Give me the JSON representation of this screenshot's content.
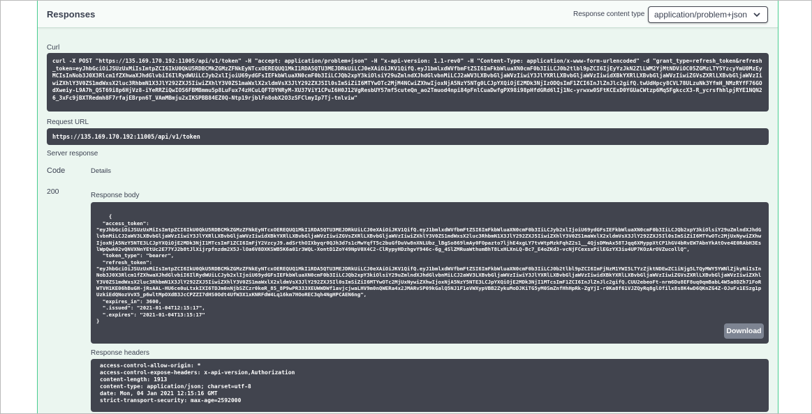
{
  "responses": {
    "title": "Responses",
    "content_type_label": "Response content type",
    "content_type_value": "application/problem+json"
  },
  "curl": {
    "label": "Curl",
    "command": "curl -X POST \"https://135.169.170.192:11005/api/v1/token\" -H \"accept: application/problem+json\" -H \"x-api-version: 1.1-rev0\" -H \"Content-Type: application/x-www-form-urlencoded\" -d \"grant_type=refresh_token&refresh_token=eyJhbGciOiJSUzUxMiIsImtpZCI6IkU0QkU5RDBCMkZGMzZFNkEyNTcxOEREQUQ1MkI1RDA5QTU3MEJDRkUiLCJ0eXAiOiJKV1QifQ.eyJ1bmlxdWVfbmFtZSI6ImFkbWluaXN0cmF0b3IiLCJ0b2tlbl9pZCI6IjEyYzJkN2ZlLWM2YjMtNDViOC05ZGMzLTY5YzcyYmU0MzEyMCIsInNob3J0X3Rlcm1fZXhwaXJhdGlvbiI6IlRydWUiLCJyb2xlIjoiU69ydGFsIEFkbWluaXN0cmF0b3IiLCJQb2xpY3kiOlsiY29uZmlndXJhdGlvbnMiLCJ2aWV3LXBvbGljaWVzIiwiY3JlYXRlLXBvbGljaWVzIiwidXBkYXRlLXBvbGljaWVzIiwiZGVsZXRlLXBvbGljaWVzIiwiZXhlY3V0ZS1mdWxsX2luc3RhbmN1X3JlY292ZXJ5IiwiZXhlY3V0ZS1maWxlX2xldmVsX3JlY292ZXJ5Il0sImSiZiI6MTYwOTc2MjM4NCwiZXhwIjoxNjA5NzY5NTg0LCJpYXQiOjE2MDk3NjIzODQsImF1ZCI6InJlZnJlc2gifQ.twUdHpcy8CVL78ULzuNk3YfmH_NMzRYfF76GOdXweiy-L9A7h_QST69i8p6HjVz8-iYeRRZiQwIOS6FBMBmmu5p8LuFux74zHCuLQFTDYNRyM-XU37ViY1CPuI6H0J12VgResbUY57mf5cuteQn_ao2Tmuod4npi84pFnlCuaDwfgPX98i98pHfdGRd6lIj1Nc-yrwxw0SFtKCExD0YGUaCWtzp6MqSFgkccX3-R_ycrsfhhlpjRYE1NQN26_3xFc9jBXTRedmh8F7rfajEBrpn6T_VAmMBmju2xIKSPBB84EZ0Q-Ntp19rjblFn8obX2O3zSFClmyIp7Tj-tnlviw\""
  },
  "request_url": {
    "label": "Request URL",
    "value": "https://135.169.170.192:11005/api/v1/token"
  },
  "server_response": {
    "label": "Server response",
    "code_header": "Code",
    "details_header": "Details",
    "code": "200",
    "body_label": "Response body",
    "body_text": "{\n  \"access_token\":\n\"eyJhbGciOiJSUzUxMiIsImtpZCI6IkU0QkU5RDBCMkZGMzZFNkEyNTcxOEREQUQ1MkI1RDA5QTU3MEJDRkUiLCJ0eXAiOiJKV1QifQ.eyJ1bmlxdWVfbmFtZSI6ImFkbWluaXN0cmF0b3IiLCJyb2xlIjoiU69ydGFsIEFkbWluaXN0cmF0b3IiLCJQb2xpY3kiOlsiY29uZmlndXJhdGlvbnMiLCJ2aWV3LXBvbGljaWVzIiwiY3JlYXRlLXBvbGljaWVzIiwidXBkYXRlLXBvbGljaWVzIiwiZGVsZXRlLXBvbGljaWVzIiwiZXhlY3V0ZS1mdWxsX2luc3RhbmN1X3JlY292ZXJ5IiwiZXhlY3V0ZS1maWxlX2xldmVsX3JlY292ZXJ5Il0sImSiZiI6MTYwOTc2MjUxNywiZXhwIjoxNjA5NzY5NTE3LCJpYXQiOjE2MDk3NjI1MTcsImF1ZCI6ImFjY2VzcyJ9.adSrthOIXbyqr0QJh3d7s1cMwYqfT5c2buGfDuVw8nXNLUbz_lBgSo869lmAy0FOpazto7ljhE4xgLY7tvWtpMzkFqhZ2s1__4QjsDMmAx58TJqq6XMyppXtCP1hGV4bRvEW7AbnYkAtOve4E0RAbH3EslWpQwA02vQNVXNnYEtUc2E77YJ2b8tJlXijrpfnzdm2X5J-lOa6V8DXKSWB5K6a01r3WQL-XontD1ZoY49NpV0X4C2-ClRypyHDzhgvY946c-6g_4SlZMRuaWthumBhT8LxHLXnLQ-Bc7_E4oZKd3-vcNjFCexsxPilEGzYX3iu4UP7KOzArOVZucollQ\",\n  \"token_type\": \"bearer\",\n  \"refresh_token\":\n\"eyJhbGciOiJSUzUxMiIsImtpZCI6IkU0QkU5RDBCMkZGMzZFNkEyNTcxOEREQUQ1MkI1RDA5QTU3MEJDRkUiLCJ0eXAiOiJKV1QifQ.eyJ1bmlxdWVfbmFtZSI6ImFkbWluaXN0cmF0b3IiLCJ0b2tlbl9pZCI6ImFjNzM1YWI5LTYzZjktNDEwZC1iNjg5LTQyMWY5YWNlZjkyNiIsInNob3J0X3Rlcm1fZXhwaXJhdGlvbiI6IlRydWUiLCJyb2xlIjoiU69ydGFsIEFkbWluaXN0cmF0b3IiLCJQb2xpY3kiOlsiY29uZmlndXJhdGlvbnMiLCJ2aWV3LXBvbGljaWVzIiwiY3JlYXRlLXBvbGljaWVzIiwidXBkYXRlLXBvbGljaWVzIiwiZGVsZXRlLXBvbGljaWVzIiwiZXhlY3V0ZS1mdWxsX2luc3RhbmN1X3JlY292ZXJ5IiwiZXhlY3V0ZS1maWxlX2xldmVsX3JlY292ZXJ5Il0sImSiZiI6MTYwOTc2MjUxNywiZXhwIjoxNjA5NzY5NTE3LCJpYXQiOjE2MDk3NjI1MTcsImF1ZCI6InJlZnJlc2gifQ.CUU2ebeoFt-nrm6Du8EF8uq0qmBabL4W5a8DZh71FoRWTVH1KE06hBuGH-jRsAAL-HU6ce0uLtxkIXI6TDJm0nNjbSZCzr0keR_85_8P9wPR333XEUWWDWf1avjcjwaLHV9m0nQWERa4x2JMARvSP09kGalQ5NJ1F1eVWXypVBB2ZykuMoDJKiTG5yM0SmZnfHhHpRk-ZgYjI-r0Ka8f61VJZQyRq8glOfilx8s8K4wD6QKnZG4Z-OJuFx1ESzg1pUzkiEdQNozVvX5_p6wltMpOXdB3JcCPZZI7dHS0Odt4UfW3X1xKNRFdW4Lq16km7HOoREC3qh4NgHPCAEN6ng\",\n  \"expires_in\": 3600,\n  \".issued\": \"2021-01-04T12:15:17\",\n  \".expires\": \"2021-01-04T13:15:17\"\n}",
    "download_label": "Download",
    "headers_label": "Response headers",
    "headers_text": "access-control-allow-origin: *\naccess-control-expose-headers: x-api-version,Authorization\ncontent-length: 1913\ncontent-type: application/json; charset=utf-8\ndate: Mon, 04 Jan 2021 12:15:16 GMT\nstrict-transport-security: max-age=2592000"
  },
  "colors": {
    "panel_bg": "#ebf6f0",
    "panel_border": "#49cc90",
    "code_bg": "#41444e",
    "button_bg": "#7d8492"
  }
}
